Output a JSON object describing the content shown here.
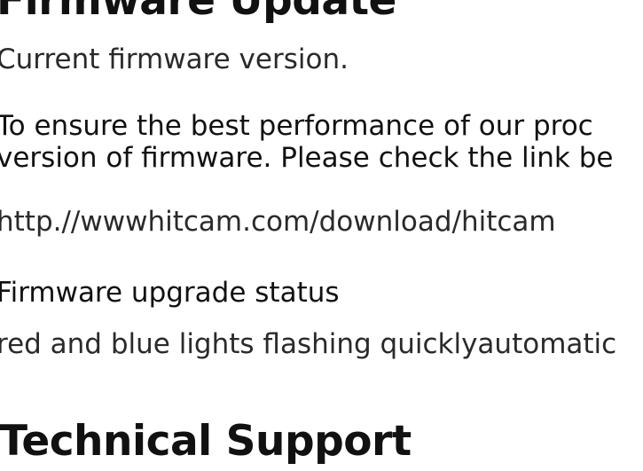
{
  "firmware_update": {
    "heading": "Firmware Update",
    "current_version_label": "Current firmware version.",
    "intro_line_1": "To ensure the best performance of our proc",
    "intro_line_2": "version of firmware. Please check the link be",
    "download_link": "http.//wwwhitcam.com/download/hitcam",
    "status_label": "Firmware upgrade status",
    "status_description": "red and blue lights flashing quicklyautomatic"
  },
  "technical_support": {
    "heading": "Technical Support"
  }
}
